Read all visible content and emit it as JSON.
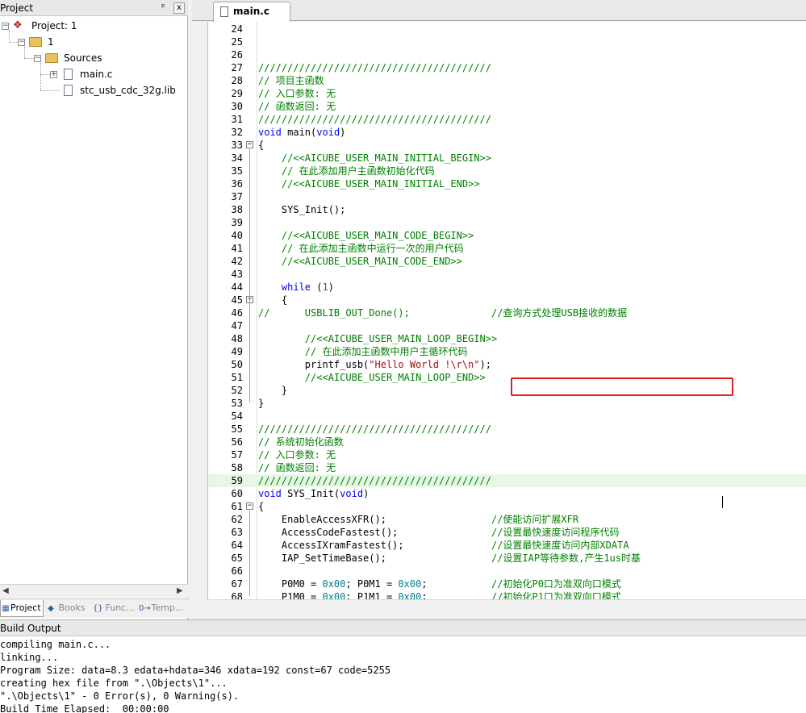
{
  "project_pane": {
    "title": "Project",
    "pin_glyph": "ᵖ",
    "close_glyph": "x",
    "tree": {
      "root": "Project: 1",
      "target": "1",
      "group": "Sources",
      "files": [
        "main.c",
        "stc_usb_cdc_32g.lib"
      ]
    },
    "tabs": [
      {
        "label": "Project",
        "icon": "project-window-icon",
        "glyph": "▦"
      },
      {
        "label": "Books",
        "icon": "books-icon",
        "glyph": "◆"
      },
      {
        "label": "Func...",
        "icon": "functions-icon",
        "glyph": "{}"
      },
      {
        "label": "Temp...",
        "icon": "templates-icon",
        "glyph": "0→"
      }
    ]
  },
  "editor": {
    "tab_label": "main.c",
    "lines": [
      {
        "n": "24",
        "text": ""
      },
      {
        "n": "25",
        "text": ""
      },
      {
        "n": "26",
        "text": ""
      },
      {
        "n": "27",
        "text": "////////////////////////////////////////"
      },
      {
        "n": "28",
        "text": "// 项目主函数"
      },
      {
        "n": "29",
        "text": "// 入口参数: 无"
      },
      {
        "n": "30",
        "text": "// 函数返回: 无"
      },
      {
        "n": "31",
        "text": "////////////////////////////////////////"
      },
      {
        "n": "32",
        "text": "void main(void)"
      },
      {
        "n": "33",
        "text": "{"
      },
      {
        "n": "34",
        "text": "    //<<AICUBE_USER_MAIN_INITIAL_BEGIN>>"
      },
      {
        "n": "35",
        "text": "    // 在此添加用户主函数初始化代码"
      },
      {
        "n": "36",
        "text": "    //<<AICUBE_USER_MAIN_INITIAL_END>>"
      },
      {
        "n": "37",
        "text": ""
      },
      {
        "n": "38",
        "text": "    SYS_Init();"
      },
      {
        "n": "39",
        "text": ""
      },
      {
        "n": "40",
        "text": "    //<<AICUBE_USER_MAIN_CODE_BEGIN>>"
      },
      {
        "n": "41",
        "text": "    // 在此添加主函数中运行一次的用户代码"
      },
      {
        "n": "42",
        "text": "    //<<AICUBE_USER_MAIN_CODE_END>>"
      },
      {
        "n": "43",
        "text": ""
      },
      {
        "n": "44",
        "text": "    while (1)"
      },
      {
        "n": "45",
        "text": "    {"
      },
      {
        "n": "46",
        "text": "//      USBLIB_OUT_Done();              //查询方式处理USB接收的数据"
      },
      {
        "n": "47",
        "text": ""
      },
      {
        "n": "48",
        "text": "        //<<AICUBE_USER_MAIN_LOOP_BEGIN>>"
      },
      {
        "n": "49",
        "text": "        // 在此添加主函数中用户主循环代码"
      },
      {
        "n": "50",
        "text": "        printf_usb(\"Hello World !\\r\\n\");"
      },
      {
        "n": "51",
        "text": "        //<<AICUBE_USER_MAIN_LOOP_END>>"
      },
      {
        "n": "52",
        "text": "    }"
      },
      {
        "n": "53",
        "text": "}"
      },
      {
        "n": "54",
        "text": ""
      },
      {
        "n": "55",
        "text": "////////////////////////////////////////"
      },
      {
        "n": "56",
        "text": "// 系统初始化函数"
      },
      {
        "n": "57",
        "text": "// 入口参数: 无"
      },
      {
        "n": "58",
        "text": "// 函数返回: 无"
      },
      {
        "n": "59",
        "text": "////////////////////////////////////////"
      },
      {
        "n": "60",
        "text": "void SYS_Init(void)"
      },
      {
        "n": "61",
        "text": "{"
      },
      {
        "n": "62",
        "text": "    EnableAccessXFR();                  //使能访问扩展XFR"
      },
      {
        "n": "63",
        "text": "    AccessCodeFastest();                //设置最快速度访问程序代码"
      },
      {
        "n": "64",
        "text": "    AccessIXramFastest();               //设置最快速度访问内部XDATA"
      },
      {
        "n": "65",
        "text": "    IAP_SetTimeBase();                  //设置IAP等待参数,产生1us时基"
      },
      {
        "n": "66",
        "text": ""
      },
      {
        "n": "67",
        "text": "    P0M0 = 0x00; P0M1 = 0x00;           //初始化P0口为准双向口模式"
      },
      {
        "n": "68",
        "text": "    P1M0 = 0x00; P1M1 = 0x00;           //初始化P1口为准双向口模式"
      }
    ]
  },
  "build_output": {
    "title": "Build Output",
    "lines": [
      "compiling main.c...",
      "linking...",
      "Program Size: data=8.3 edata+hdata=346 xdata=192 const=67 code=5255",
      "creating hex file from \".\\Objects\\1\"...",
      "\".\\Objects\\1\" - 0 Error(s), 0 Warning(s).",
      "Build Time Elapsed:  00:00:00"
    ]
  },
  "colors": {
    "comment": "#008000",
    "keyword": "#0000ff",
    "string": "#a01010",
    "number": "#00808a",
    "highlight_box": "#e02020",
    "current_line": "#e6f7e6"
  }
}
